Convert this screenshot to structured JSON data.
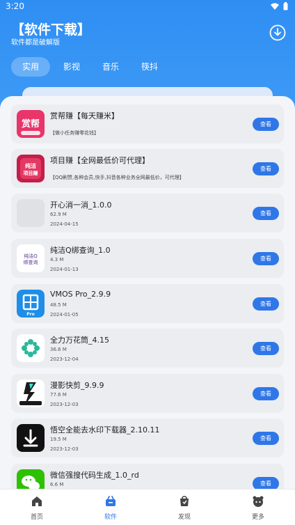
{
  "status_bar": {
    "time": "3:20"
  },
  "header": {
    "title": "【软件下载】",
    "subtitle": "软件都是破解版",
    "download_icon": "download-circle-icon"
  },
  "tabs": [
    {
      "label": "实用",
      "active": true
    },
    {
      "label": "影视",
      "active": false
    },
    {
      "label": "音乐",
      "active": false
    },
    {
      "label": "筷抖",
      "active": false
    }
  ],
  "apps": [
    {
      "name": "赏帮赚【每天赚米】",
      "desc": "【做小任务赚零花钱】",
      "button": "查看",
      "icon": "shangbang-icon"
    },
    {
      "name": "项目赚【全网最低价可代理】",
      "desc": "【QQ刷赞,各种会员,快手,抖音各种业务全网最低价，可代理】",
      "button": "查看",
      "icon": "xiangmu-icon"
    },
    {
      "name": "开心消一消_1.0.0",
      "size": "62.9 M",
      "date": "2024-04-15",
      "button": "查看",
      "icon": "placeholder-icon"
    },
    {
      "name": "纯洁Q绑查询_1.0",
      "size": "4.3 M",
      "date": "2024-01-13",
      "button": "查看",
      "icon": "q-bind-icon"
    },
    {
      "name": "VMOS Pro_2.9.9",
      "size": "48.5 M",
      "date": "2024-01-05",
      "button": "查看",
      "icon": "vmos-icon"
    },
    {
      "name": "全力万花筒_4.15",
      "size": "36.6 M",
      "date": "2023-12-04",
      "button": "查看",
      "icon": "kaleidoscope-icon"
    },
    {
      "name": "漫影快剪_9.9.9",
      "size": "77.6 M",
      "date": "2023-12-03",
      "button": "查看",
      "icon": "video-edit-icon"
    },
    {
      "name": "悟空全能去水印下载器_2.10.11",
      "size": "19.5 M",
      "date": "2023-12-03",
      "button": "查看",
      "icon": "download-arrow-icon"
    },
    {
      "name": "微信强搜代码生成_1.0_rd",
      "size": "6.6 M",
      "date": "",
      "button": "查看",
      "icon": "wechat-icon"
    }
  ],
  "bottom_nav": [
    {
      "label": "首页",
      "icon": "home-icon",
      "active": false
    },
    {
      "label": "软件",
      "icon": "software-icon",
      "active": true
    },
    {
      "label": "发现",
      "icon": "discover-icon",
      "active": false
    },
    {
      "label": "更多",
      "icon": "more-icon",
      "active": false
    }
  ],
  "colors": {
    "primary": "#2f8ef3",
    "button": "#2f77e8",
    "card": "#ebedf1"
  }
}
